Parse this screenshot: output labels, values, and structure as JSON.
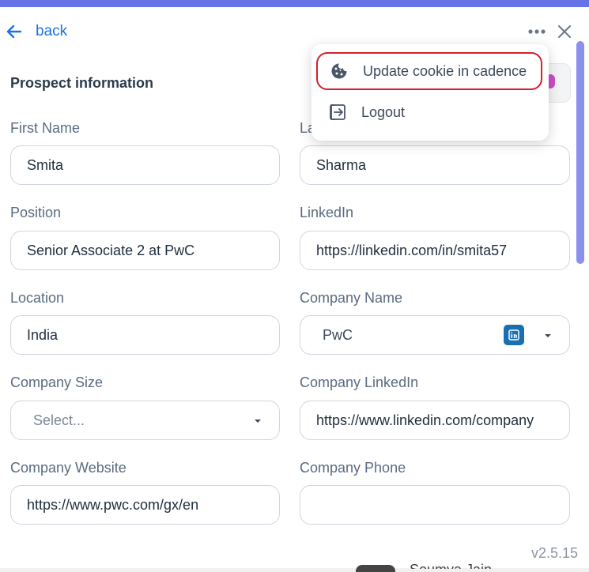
{
  "header": {
    "back_label": "back"
  },
  "section": {
    "title": "Prospect information"
  },
  "fields": {
    "first_name": {
      "label": "First Name",
      "value": "Smita"
    },
    "last_name": {
      "label_visible": "La",
      "value": "Sharma"
    },
    "position": {
      "label": "Position",
      "value": "Senior Associate 2 at PwC"
    },
    "linkedin": {
      "label": "LinkedIn",
      "value": "https://linkedin.com/in/smita57"
    },
    "location": {
      "label": "Location",
      "value": "India"
    },
    "company_name": {
      "label": "Company Name",
      "value": "PwC"
    },
    "company_size": {
      "label": "Company Size",
      "placeholder": "Select..."
    },
    "company_linkedin": {
      "label": "Company LinkedIn",
      "value": "https://www.linkedin.com/company"
    },
    "company_website": {
      "label": "Company Website",
      "value": "https://www.pwc.com/gx/en"
    },
    "company_phone": {
      "label": "Company Phone",
      "value": ""
    }
  },
  "menu": {
    "items": [
      {
        "label": "Update cookie in cadence",
        "icon": "cookie-icon",
        "highlighted": true
      },
      {
        "label": "Logout",
        "icon": "logout-icon",
        "highlighted": false
      }
    ]
  },
  "footer": {
    "version": "v2.5.15",
    "partial_text": "Soumya Jain"
  },
  "colors": {
    "accent": "#6772e5",
    "link": "#1a73e8",
    "highlight_border": "#d61f2c",
    "linkedin_blue": "#1a6fb0"
  }
}
